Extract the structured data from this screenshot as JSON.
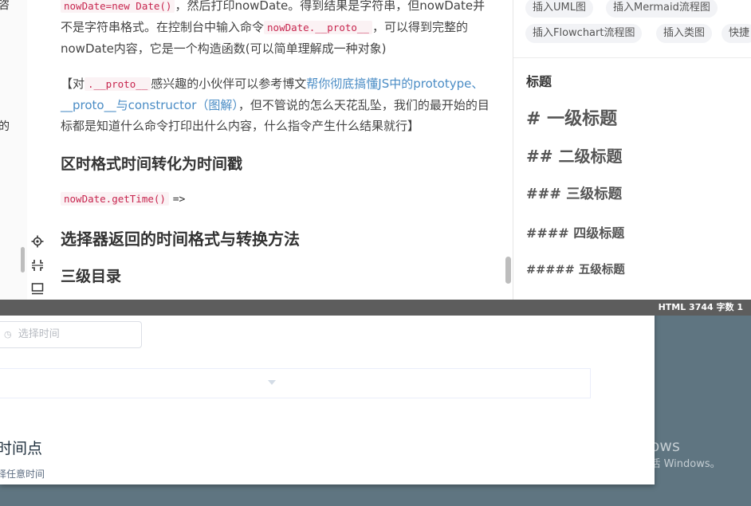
{
  "desktop": {
    "activate_title": "激活 Windows",
    "activate_subtitle": "转到“设置”以激活 Windows。"
  },
  "back_page": {
    "date_placeholder": "选择时间",
    "section_title": "时间点",
    "section_desc": "择任意时间"
  },
  "editor": {
    "left_fragments": [
      "咨",
      "的"
    ],
    "content": {
      "top_code": "nowDate=new Date()",
      "top_text_after": "，然后打印nowDate。得到结果是字符串，但nowDate并",
      "p1_a": "不是字符串格式。在控制台中输入命令",
      "p1_code": "nowDate.__proto__",
      "p1_b": "，可以得到完整的",
      "p1_c": "nowDate内容，它是一个构造函数(可以简单理解成一种对象)",
      "p2_a": "【对",
      "p2_code": ".__proto__",
      "p2_b": "感兴趣的小伙伴可以参考博文",
      "p2_link": "帮你彻底搞懂JS中的prototype、__proto__与constructor（图解）",
      "p2_c": "，但不管说的怎么天花乱坠，我们的最开始的目标都是知道什么命令打印出什么内容，什么指令产生什么结果就行】",
      "h_convert": "区时格式时间转化为时间戳",
      "code_gettime": "nowDate.getTime()",
      "arrow": "=>",
      "h_selector": "选择器返回的时间格式与转换方法",
      "h_level3": "三级目录"
    },
    "right_panel": {
      "chips": [
        "插入UML图",
        "插入Mermaid流程图",
        "插入Flowchart流程图",
        "插入类图",
        "快捷"
      ],
      "title_label": "标题",
      "headings": [
        "# 一级标题",
        "## 二级标题",
        "### 三级标题",
        "#### 四级标题",
        "##### 五级标题"
      ]
    },
    "statusbar": {
      "text": "HTML  3744 字数  1"
    }
  }
}
